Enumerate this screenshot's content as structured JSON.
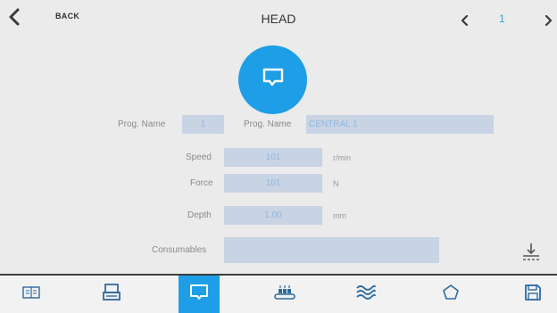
{
  "header": {
    "back_label": "BACK",
    "title": "HEAD",
    "page_number": "1"
  },
  "mode_icon": "chat-bubble-icon",
  "form": {
    "prog_number_label": "Prog. Name",
    "prog_number_value": "1",
    "prog_name_label": "Prog. Name",
    "prog_name_value": "CENTRAL 1",
    "speed_label": "Speed",
    "speed_value": "101",
    "speed_unit": "r/min",
    "force_label": "Force",
    "force_value": "101",
    "force_unit": "N",
    "depth_label": "Depth",
    "depth_value": "1.00",
    "depth_unit": "mm",
    "consumables_label": "Consumables",
    "consumables_value": ""
  },
  "toolbar": {
    "items": [
      {
        "icon": "book-icon",
        "active": false
      },
      {
        "icon": "scale-icon",
        "active": false
      },
      {
        "icon": "chat-bubble-icon",
        "active": true
      },
      {
        "icon": "conveyor-icon",
        "active": false
      },
      {
        "icon": "waves-icon",
        "active": false
      },
      {
        "icon": "pentagon-icon",
        "active": false
      },
      {
        "icon": "save-icon",
        "active": false
      }
    ]
  },
  "colors": {
    "accent": "#1e9ee6",
    "field_bg": "#c8d3e4",
    "field_text": "#8fb8e0",
    "screen_bg": "#ebebeb"
  }
}
